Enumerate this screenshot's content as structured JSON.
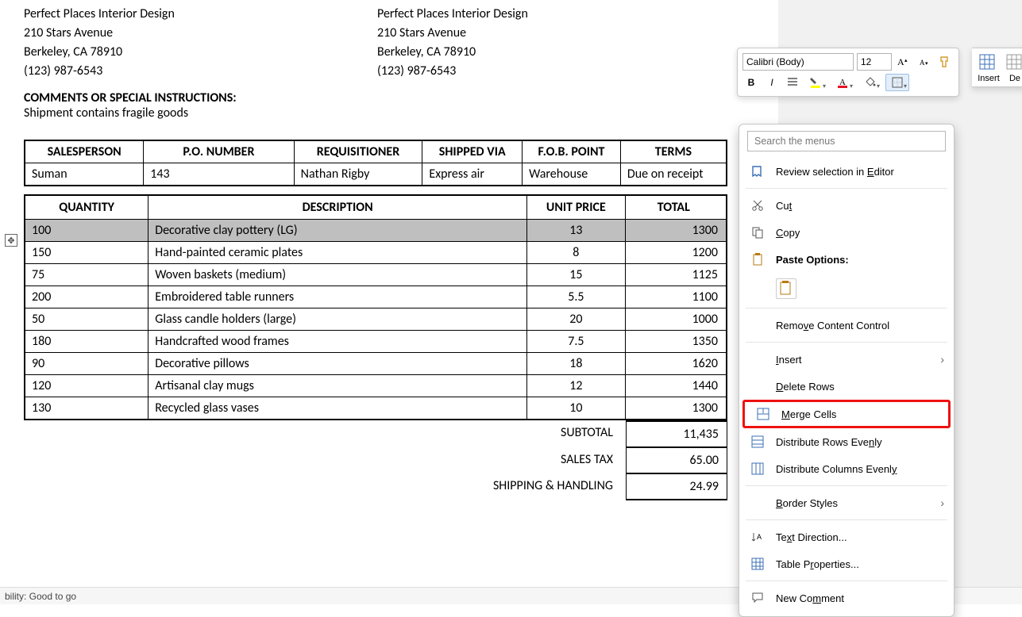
{
  "company": {
    "name": "Perfect Places Interior Design",
    "street": "210 Stars Avenue",
    "city": "Berkeley, CA 78910",
    "phone": "(123) 987-6543"
  },
  "comments": {
    "heading": "COMMENTS OR SPECIAL INSTRUCTIONS:",
    "text": "Shipment contains fragile goods"
  },
  "order_header": {
    "cols": [
      "SALESPERSON",
      "P.O. NUMBER",
      "REQUISITIONER",
      "SHIPPED VIA",
      "F.O.B. POINT",
      "TERMS"
    ],
    "vals": [
      "Suman",
      "143",
      "Nathan Rigby",
      "Express air",
      "Warehouse",
      "Due on receipt"
    ]
  },
  "items_header": [
    "QUANTITY",
    "DESCRIPTION",
    "UNIT PRICE",
    "TOTAL"
  ],
  "items": [
    {
      "qty": "100",
      "desc": "Decorative clay pottery (LG)",
      "unit": "13",
      "total": "1300",
      "selected": true
    },
    {
      "qty": "150",
      "desc": "Hand-painted ceramic plates",
      "unit": "8",
      "total": "1200"
    },
    {
      "qty": "75",
      "desc": "Woven baskets (medium)",
      "unit": "15",
      "total": "1125"
    },
    {
      "qty": "200",
      "desc": "Embroidered table runners",
      "unit": "5.5",
      "total": "1100"
    },
    {
      "qty": "50",
      "desc": "Glass candle holders (large)",
      "unit": "20",
      "total": "1000"
    },
    {
      "qty": "180",
      "desc": "Handcrafted wood frames",
      "unit": "7.5",
      "total": "1350"
    },
    {
      "qty": "90",
      "desc": "Decorative pillows",
      "unit": "18",
      "total": "1620"
    },
    {
      "qty": "120",
      "desc": "Artisanal clay mugs",
      "unit": "12",
      "total": "1440"
    },
    {
      "qty": "130",
      "desc": "Recycled glass vases",
      "unit": "10",
      "total": "1300"
    }
  ],
  "totals": {
    "subtotal_label": "SUBTOTAL",
    "subtotal": "11,435",
    "tax_label": "SALES TAX",
    "tax": "65.00",
    "ship_label": "SHIPPING & HANDLING",
    "ship": "24.99"
  },
  "mini_toolbar": {
    "font": "Calibri (Body)",
    "size": "12",
    "insert": "Insert",
    "delete": "De"
  },
  "context_menu": {
    "search_placeholder": "Search the menus",
    "review": "Review selection in Editor",
    "cut": "Cut",
    "copy": "Copy",
    "paste_heading": "Paste Options:",
    "remove_cc": "Remove Content Control",
    "insert": "Insert",
    "delete_rows": "Delete Rows",
    "merge": "Merge Cells",
    "dist_rows": "Distribute Rows Evenly",
    "dist_cols": "Distribute Columns Evenly",
    "border": "Border Styles",
    "text_dir": "Text Direction...",
    "table_props": "Table Properties...",
    "new_comment": "New Comment"
  },
  "status": {
    "text": "bility: Good to go"
  }
}
